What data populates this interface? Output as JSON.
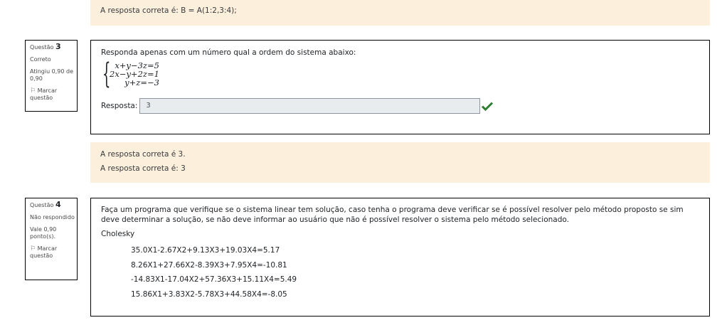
{
  "prev_feedback": {
    "text": "A resposta correta é: B = A(1:2,3:4);"
  },
  "q3": {
    "info": {
      "label": "Questão",
      "number": "3",
      "status": "Correto",
      "grade": "Atingiu 0,90 de 0,90",
      "flag_label": "Marcar questão",
      "flag_icon": "flag-icon"
    },
    "text": "Responda apenas com um número qual a ordem do sistema abaixo:",
    "equations": [
      "x+y−3z=5",
      "2x−y+2z=1",
      "y+z=−3"
    ],
    "answer_label": "Resposta:",
    "answer_value": "3",
    "check_icon": "check-icon",
    "check_color": "#2e7d32",
    "feedback": [
      "A resposta correta é 3.",
      "A resposta correta é: 3"
    ]
  },
  "q4": {
    "info": {
      "label": "Questão",
      "number": "4",
      "status": "Não respondido",
      "grade": "Vale 0,90 ponto(s).",
      "flag_label": "Marcar questão",
      "flag_icon": "flag-icon"
    },
    "text": "Faça um programa que verifique se o sistema linear tem solução, caso tenha o programa deve verificar se é possível resolver pelo método proposto se sim deve determinar a solução, se não deve informar ao usuário que não é possível resolver o sistema pelo método selecionado.",
    "method": "Cholesky",
    "equations": [
      "35.0X1-2.67X2+9.13X3+19.03X4=5.17",
      "8.26X1+27.66X2-8.39X3+7.95X4=-10.81",
      "-14.83X1-17.04X2+57.36X3+15.11X4=5.49",
      "15.86X1+3.83X2-5.78X3+44.58X4=-8.05"
    ]
  },
  "colors": {
    "feedback_bg": "#fcefdc"
  }
}
